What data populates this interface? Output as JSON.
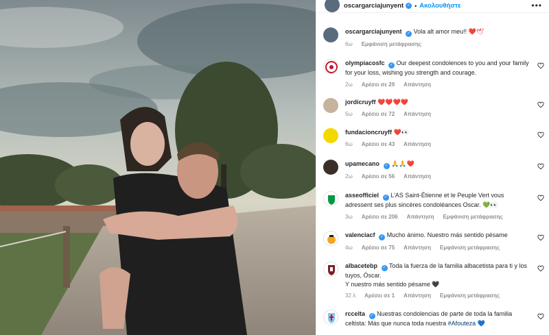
{
  "post": {
    "username": "oscargarciajunyent",
    "follow_label": "Ακολουθήστε",
    "more": "•••"
  },
  "caption": {
    "username": "oscargarciajunyent",
    "text": "Vola alt amor meu!!",
    "emoji": "❤️🕊",
    "time": "6ω",
    "translate": "Εμφάνιση μετάφρασης"
  },
  "comments": [
    {
      "username": "olympiacosfc",
      "text": "Our deepest condolences to you and your family for your loss, wishing you strength and courage.",
      "time": "2ω",
      "likes": "Αρέσει σε 29",
      "reply": "Απάντηση",
      "translate": ""
    },
    {
      "username": "jordicruyff",
      "text": "",
      "emoji": "❤️❤️❤️❤️",
      "time": "5ω",
      "likes": "Αρέσει σε 72",
      "reply": "Απάντηση",
      "translate": ""
    },
    {
      "username": "fundacioncruyff",
      "text": "",
      "emoji": "❤️👀",
      "time": "6ω",
      "likes": "Αρέσει σε 43",
      "reply": "Απάντηση",
      "translate": ""
    },
    {
      "username": "upamecano",
      "text": "",
      "emoji": "🙏🙏❤️",
      "time": "2ω",
      "likes": "Αρέσει σε 56",
      "reply": "Απάντηση",
      "translate": ""
    },
    {
      "username": "asseofficiel",
      "text": "L'AS Saint-Étienne et le Peuple Vert vous adressent ses plus sincères condoléances Oscar.",
      "emoji": "💚👀",
      "time": "3ω",
      "likes": "Αρέσει σε 206",
      "reply": "Απάντηση",
      "translate": "Εμφάνιση μετάφρασης"
    },
    {
      "username": "valenciacf",
      "text": "Mucho ánimo. Nuestro más sentido pésame",
      "time": "4ω",
      "likes": "Αρέσει σε 75",
      "reply": "Απάντηση",
      "translate": "Εμφάνιση μετάφρασης"
    },
    {
      "username": "albacetebp",
      "text": "Toda la fuerza de la familia albacetista para ti y los tuyos, Óscar.",
      "text2": "Y nuestro más sentido pésame",
      "emoji": "🖤",
      "time": "32 λ",
      "likes": "Αρέσει σε 1",
      "reply": "Απάντηση",
      "translate": "Εμφάνιση μετάφρασης"
    },
    {
      "username": "rccelta",
      "text": "Nuestras condolencias de parte de toda la familia celtista: Más que nunca toda nuestra",
      "hashtag": "#Afouteza",
      "emoji": "💙"
    }
  ],
  "colors": {
    "link_blue": "#0095f6",
    "verified_blue": "#3897f0",
    "meta_gray": "#8e8e8e",
    "heart_red": "#ed4956"
  },
  "icons": {
    "verified": "verified-badge-icon",
    "like": "heart-outline-icon",
    "more": "more-options-icon"
  }
}
